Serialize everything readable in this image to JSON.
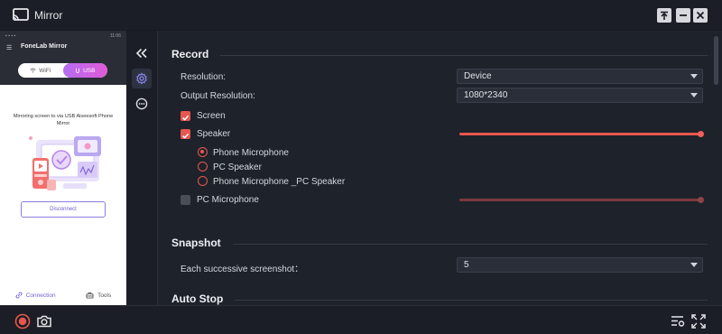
{
  "window": {
    "title": "Mirror",
    "icons": [
      "mirror-app-icon",
      "pin-icon",
      "minimize-icon",
      "close-icon"
    ]
  },
  "phone": {
    "status_time": "11:06",
    "app_title": "FoneLab Mirror",
    "toggle": {
      "wifi": "WiFi",
      "usb": "USB",
      "selected": "USB"
    },
    "mirror_text": "Mirroring screen to via USB Aiseesoft Phone Mirror",
    "disconnect": "Disconnect",
    "nav": {
      "connection": "Connection",
      "tools": "Tools"
    }
  },
  "rail": {
    "icons": [
      "collapse-icon",
      "settings-gear-icon",
      "more-icon"
    ],
    "active": "settings-gear-icon"
  },
  "record": {
    "title": "Record",
    "resolution_label": "Resolution:",
    "resolution_value": "Device",
    "output_resolution_label": "Output Resolution:",
    "output_resolution_value": "1080*2340",
    "screen_label": "Screen",
    "screen_checked": true,
    "speaker_label": "Speaker",
    "speaker_checked": true,
    "speaker_volume": 1.0,
    "audio_options": [
      "Phone Microphone",
      "PC Speaker",
      "Phone Microphone _PC Speaker"
    ],
    "audio_selected": "Phone Microphone",
    "pc_mic_label": "PC Microphone",
    "pc_mic_checked": false,
    "pc_mic_volume": 1.0
  },
  "snapshot": {
    "title": "Snapshot",
    "successive_label": "Each successive screenshot：",
    "successive_value": "5"
  },
  "auto_stop": {
    "title": "Auto Stop"
  },
  "bottom": {
    "icons": [
      "record-icon",
      "camera-icon",
      "list-settings-icon",
      "fullscreen-icon"
    ]
  },
  "colors": {
    "accent": "#e8574f",
    "usb_gradient_start": "#b56df0",
    "usb_gradient_end": "#e05ad7",
    "background": "#1e222b"
  }
}
